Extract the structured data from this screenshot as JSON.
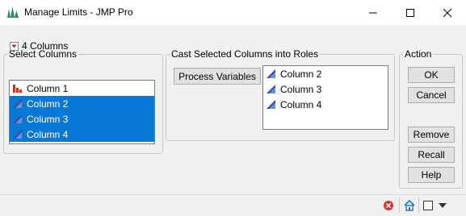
{
  "window": {
    "title": "Manage Limits - JMP Pro",
    "app_icon": "jmp-chart-icon",
    "controls": [
      "minimize-icon",
      "maximize-icon",
      "close-icon"
    ]
  },
  "select_columns": {
    "legend": "Select Columns",
    "dropdown_label": "4 Columns",
    "items": [
      {
        "label": "Column 1",
        "icon": "nominal-bar-icon",
        "selected": false
      },
      {
        "label": "Column 2",
        "icon": "continuous-triangle-icon",
        "selected": true
      },
      {
        "label": "Column 3",
        "icon": "continuous-triangle-icon",
        "selected": true
      },
      {
        "label": "Column 4",
        "icon": "continuous-triangle-icon",
        "selected": true
      }
    ]
  },
  "cast_roles": {
    "legend": "Cast Selected Columns into Roles",
    "role_button": "Process Variables",
    "items": [
      {
        "label": "Column 2",
        "icon": "continuous-triangle-icon"
      },
      {
        "label": "Column 3",
        "icon": "continuous-triangle-icon"
      },
      {
        "label": "Column 4",
        "icon": "continuous-triangle-icon"
      }
    ]
  },
  "action": {
    "legend": "Action",
    "ok": "OK",
    "cancel": "Cancel",
    "remove": "Remove",
    "recall": "Recall",
    "help": "Help"
  },
  "statusbar": {
    "icons": [
      "error-stop-icon",
      "home-icon",
      "window-square-icon",
      "dropdown-arrow-icon"
    ]
  },
  "colors": {
    "selection": "#0a78d7",
    "continuous_icon": "#2b4ea0",
    "nominal_icon": "#c0392b"
  }
}
